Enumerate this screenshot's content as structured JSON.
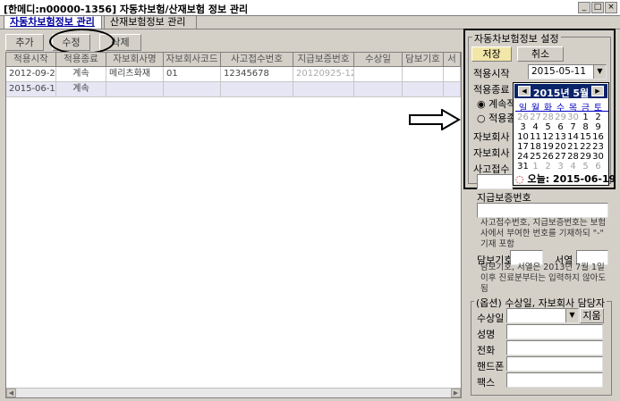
{
  "window": {
    "title": "[한메디:n00000-1356] 자동차보험/산재보험 정보 관리",
    "minimize": "_",
    "maximize": "□",
    "close": "×"
  },
  "tabs": [
    {
      "label": "자동차보험정보 관리",
      "active": true
    },
    {
      "label": "산재보험정보 관리",
      "active": false
    }
  ],
  "toolbar": {
    "add": "추가",
    "edit": "수정",
    "delete": "삭제"
  },
  "grid": {
    "columns": [
      "적용시작",
      "적용종료",
      "자보회사명",
      "자보회사코드",
      "사고접수번호",
      "지급보증번호",
      "수상일",
      "담보기호",
      "서"
    ],
    "rows": [
      [
        "2012-09-25",
        "계속",
        "메리츠화재",
        "01",
        "12345678",
        "20120925-123",
        "",
        "",
        ""
      ],
      [
        "2015-06-19",
        "계속",
        "",
        "",
        "",
        "",
        "",
        "",
        ""
      ]
    ]
  },
  "settings": {
    "title": "자동차보험정보 설정",
    "save": "저장",
    "cancel": "취소",
    "start_label": "적용시작",
    "start_value": "2015-05-11",
    "end_label": "적용종료",
    "radio_continue": "계속적",
    "radio_end": "적용종",
    "company_label": "자보회사",
    "company_code_label": "자보회사",
    "accident_label": "사고접수"
  },
  "calendar": {
    "title": "2015년 5월",
    "weekdays": [
      "일",
      "월",
      "화",
      "수",
      "목",
      "금",
      "토"
    ],
    "weeks": [
      [
        26,
        27,
        28,
        29,
        30,
        1,
        2
      ],
      [
        3,
        4,
        5,
        6,
        7,
        8,
        9
      ],
      [
        10,
        11,
        12,
        13,
        14,
        15,
        16
      ],
      [
        17,
        18,
        19,
        20,
        21,
        22,
        23
      ],
      [
        24,
        25,
        26,
        27,
        28,
        29,
        30
      ],
      [
        31,
        1,
        2,
        3,
        4,
        5,
        6
      ]
    ],
    "today_label": "오늘: 2015-06-19"
  },
  "form": {
    "guarantee_label": "지급보증번호",
    "guarantee_note": "사고접수번호, 지급보증번호는 보험사에서 부여한 번호를 기재하되 \"-\" 기재 포함",
    "collateral_label": "담보기호",
    "serial_label": "서열",
    "collateral_note": "담보기호, 서열은 2013년 7월 1일 이후 진료분부터는 입력하지 않아도 됨",
    "optional_title": "(옵션) 수상일, 자보회사 담당자",
    "injury_date_label": "수상일",
    "clear_button": "지움",
    "name_label": "성명",
    "phone_label": "전화",
    "mobile_label": "핸드폰",
    "fax_label": "팩스"
  }
}
